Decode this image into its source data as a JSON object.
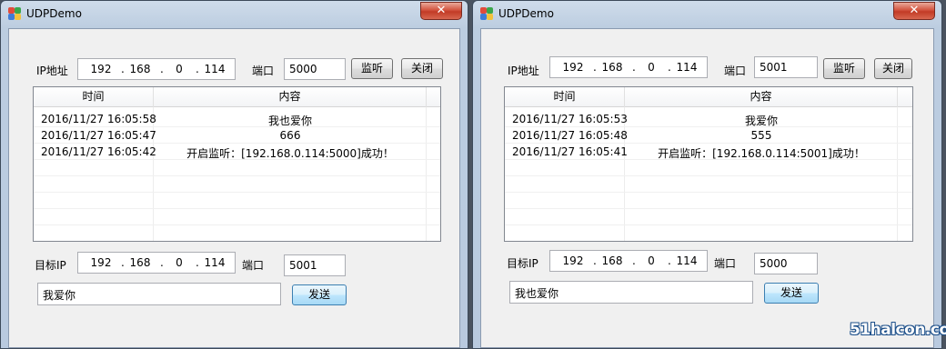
{
  "windows": [
    {
      "title": "UDPDemo",
      "close_glyph": "✕",
      "listen": {
        "ip_label": "IP地址",
        "ip": [
          "192",
          "168",
          "0",
          "114"
        ],
        "port_label": "端口",
        "port": "5000",
        "listen_button": "监听",
        "close_button": "关闭"
      },
      "table": {
        "columns": [
          "时间",
          "内容"
        ],
        "rows": [
          {
            "time": "2016/11/27 16:05:58",
            "content": "我也爱你"
          },
          {
            "time": "2016/11/27 16:05:47",
            "content": "666"
          },
          {
            "time": "2016/11/27 16:05:42",
            "content": "开启监听：[192.168.0.114:5000]成功！"
          }
        ]
      },
      "target": {
        "ip_label": "目标IP",
        "ip": [
          "192",
          "168",
          "0",
          "114"
        ],
        "port_label": "端口",
        "port": "5001"
      },
      "message": "我爱你",
      "send_button": "发送"
    },
    {
      "title": "UDPDemo",
      "close_glyph": "✕",
      "listen": {
        "ip_label": "IP地址",
        "ip": [
          "192",
          "168",
          "0",
          "114"
        ],
        "port_label": "端口",
        "port": "5001",
        "listen_button": "监听",
        "close_button": "关闭"
      },
      "table": {
        "columns": [
          "时间",
          "内容"
        ],
        "rows": [
          {
            "time": "2016/11/27 16:05:53",
            "content": "我爱你"
          },
          {
            "time": "2016/11/27 16:05:48",
            "content": "555"
          },
          {
            "time": "2016/11/27 16:05:41",
            "content": "开启监听：[192.168.0.114:5001]成功！"
          }
        ]
      },
      "target": {
        "ip_label": "目标IP",
        "ip": [
          "192",
          "168",
          "0",
          "114"
        ],
        "port_label": "端口",
        "port": "5000"
      },
      "message": "我也爱你",
      "send_button": "发送"
    }
  ],
  "watermark": "51halcon.com"
}
